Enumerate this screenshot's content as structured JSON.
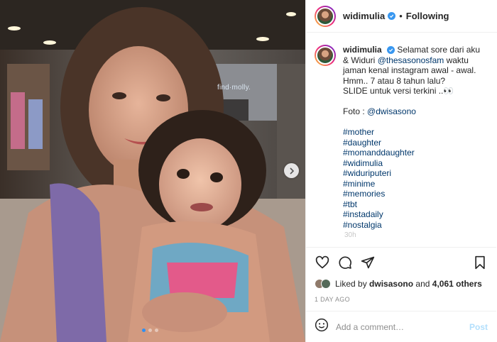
{
  "post": {
    "username": "widimulia",
    "header_sep": "•",
    "follow_status": "Following",
    "caption": {
      "text_1": "Selamat sore dari aku & Widuri",
      "mention": "@thesasonosfam",
      "text_2": "waktu jaman kenal instagram awal - awal. Hmm.. 7 atau 8 tahun lalu?",
      "line_slide": "SLIDE untuk versi terkini ..👀",
      "foto_label": "Foto :",
      "foto_mention": "@dwisasono",
      "hashtags": [
        "#mother",
        "#daughter",
        "#momanddaughter",
        "#widimulia",
        "#widuriputeri",
        "#minime",
        "#memories",
        "#tbt",
        "#instadaily",
        "#nostalgia"
      ],
      "time": "30h"
    },
    "likes": {
      "prefix": "Liked by",
      "user": "dwisasono",
      "middle": "and",
      "count_text": "4,061 others"
    },
    "date": "1 DAY AGO",
    "comment_input": {
      "placeholder": "Add a comment…"
    },
    "post_button": "Post",
    "carousel": {
      "slides": 3,
      "active": 1
    },
    "photo_sign": "find·molly.",
    "icons": {
      "like": "heart-icon",
      "comment": "comment-icon",
      "share": "send-icon",
      "save": "bookmark-icon",
      "emoji": "emoji-icon",
      "next": "chevron-right-icon",
      "verified": "verified-badge-icon"
    },
    "colors": {
      "link": "#00376b",
      "verified": "#3897f0",
      "post_disabled": "#b2dffc",
      "carousel_active": "#2f8ff0"
    }
  }
}
